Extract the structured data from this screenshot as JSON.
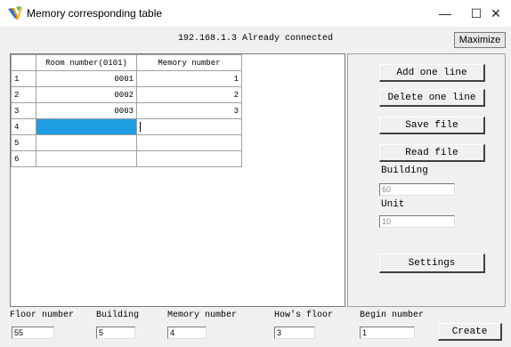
{
  "window": {
    "title": "Memory corresponding table",
    "icon": "app-logo-icon",
    "controls": {
      "minimize": "—",
      "maximize": "☐",
      "close": "✕"
    }
  },
  "status": {
    "text": "192.168.1.3 Already connected",
    "maximize_label": "Maximize"
  },
  "table": {
    "columns": [
      "",
      "Room number(0101)",
      "Memory number"
    ],
    "rows": [
      {
        "num": "1",
        "room": "0001",
        "memory": "1"
      },
      {
        "num": "2",
        "room": "0002",
        "memory": "2"
      },
      {
        "num": "3",
        "room": "0003",
        "memory": "3"
      },
      {
        "num": "4",
        "room": "",
        "memory": ""
      },
      {
        "num": "5",
        "room": "",
        "memory": ""
      },
      {
        "num": "6",
        "room": "",
        "memory": ""
      }
    ]
  },
  "panel": {
    "add_line": "Add one line",
    "delete_line": "Delete one line",
    "save_file": "Save file",
    "read_file": "Read file",
    "building_label": "Building",
    "building_value": "60",
    "unit_label": "Unit",
    "unit_value": "10",
    "settings": "Settings"
  },
  "bottom": {
    "floor_label": "Floor number",
    "floor_value": "55",
    "building_label": "Building",
    "building_value": "5",
    "memory_label": "Memory number",
    "memory_value": "4",
    "hows_floor_label": "How's floor",
    "hows_floor_value": "3",
    "begin_label": "Begin number",
    "begin_value": "1",
    "create": "Create"
  },
  "colors": {
    "selection": "#1e9fe3",
    "background": "#f0f0f0"
  }
}
